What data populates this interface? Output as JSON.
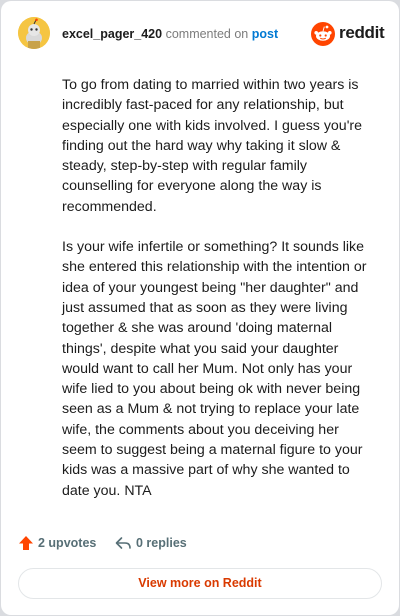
{
  "header": {
    "username": "excel_pager_420",
    "action_text": "commented on",
    "post_link": "post"
  },
  "brand": {
    "name": "reddit",
    "color": "#ff4500"
  },
  "comment": {
    "paragraphs": [
      "To go from dating to married within two years is incredibly fast-paced for any relationship, but especially one with kids involved. I guess you're finding out the hard way why taking it slow & steady, step-by-step with regular family counselling for everyone along the way is recommended.",
      "Is your wife infertile or something? It sounds like she entered this relationship with the intention or idea of your youngest being \"her daughter\" and just assumed that as soon as they were living together & she was around 'doing maternal things', despite what you said your daughter would want to call her Mum. Not only has your wife lied to you about being ok with never being seen as a Mum & not trying to replace your late wife, the comments about you deceiving her seem to suggest being a maternal figure to your kids was a massive part of why she wanted to date you. NTA"
    ]
  },
  "actions": {
    "upvotes": "2 upvotes",
    "replies": "0 replies"
  },
  "footer": {
    "view_more": "View more on Reddit"
  },
  "icons": [
    "avatar",
    "reddit-logo-icon",
    "upvote-arrow-icon",
    "reply-arrow-icon"
  ]
}
